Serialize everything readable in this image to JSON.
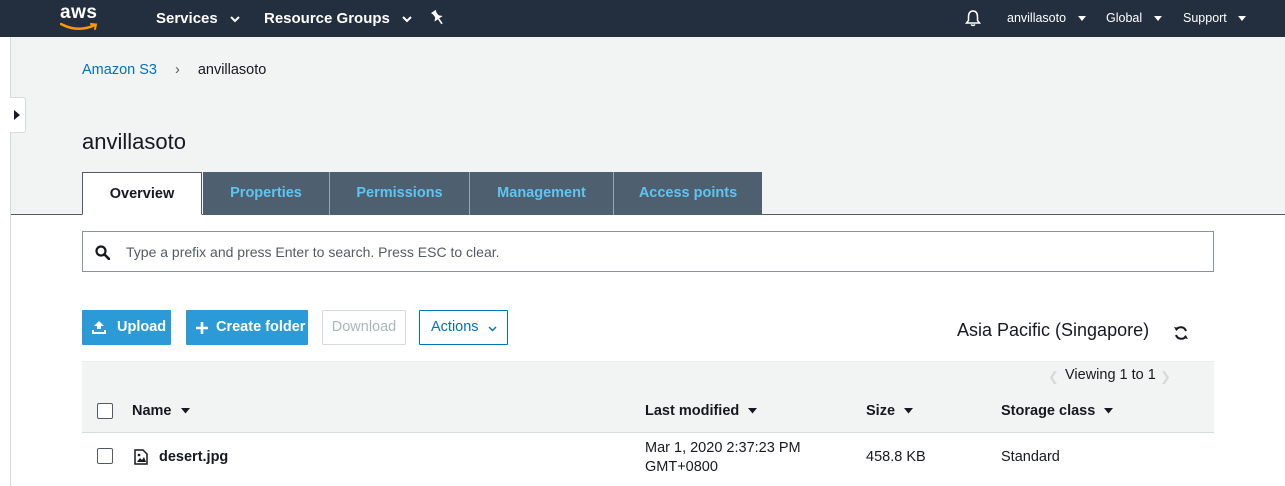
{
  "topnav": {
    "logo_text": "aws",
    "services": "Services",
    "resource_groups": "Resource Groups",
    "user": "anvillasoto",
    "region": "Global",
    "support": "Support"
  },
  "breadcrumb": {
    "root": "Amazon S3",
    "separator": "›",
    "current": "anvillasoto"
  },
  "bucket": {
    "title": "anvillasoto"
  },
  "tabs": [
    {
      "label": "Overview",
      "active": true
    },
    {
      "label": "Properties",
      "active": false
    },
    {
      "label": "Permissions",
      "active": false
    },
    {
      "label": "Management",
      "active": false
    },
    {
      "label": "Access points",
      "active": false
    }
  ],
  "search": {
    "placeholder": "Type a prefix and press Enter to search. Press ESC to clear."
  },
  "toolbar": {
    "upload": "Upload",
    "create_folder": "Create folder",
    "download": "Download",
    "actions": "Actions",
    "region_label": "Asia Pacific (Singapore)"
  },
  "table": {
    "viewing": "Viewing 1 to 1",
    "columns": [
      "Name",
      "Last modified",
      "Size",
      "Storage class"
    ],
    "rows": [
      {
        "name": "desert.jpg",
        "modified_line1": "Mar 1, 2020 2:37:23 PM",
        "modified_line2": "GMT+0800",
        "size": "458.8 KB",
        "storage_class": "Standard"
      }
    ]
  },
  "colors": {
    "nav_bg": "#232f3e",
    "primary": "#2d9ad8",
    "link": "#0073bb",
    "tab_inactive_bg": "#4e6070",
    "tab_inactive_text": "#5fc4f0"
  },
  "icons": [
    "aws-smile-icon",
    "chevron-down-icon",
    "pin-icon",
    "bell-icon",
    "expand-arrow-icon",
    "search-icon",
    "upload-icon",
    "plus-icon",
    "refresh-icon",
    "sort-down-icon",
    "image-file-icon"
  ]
}
